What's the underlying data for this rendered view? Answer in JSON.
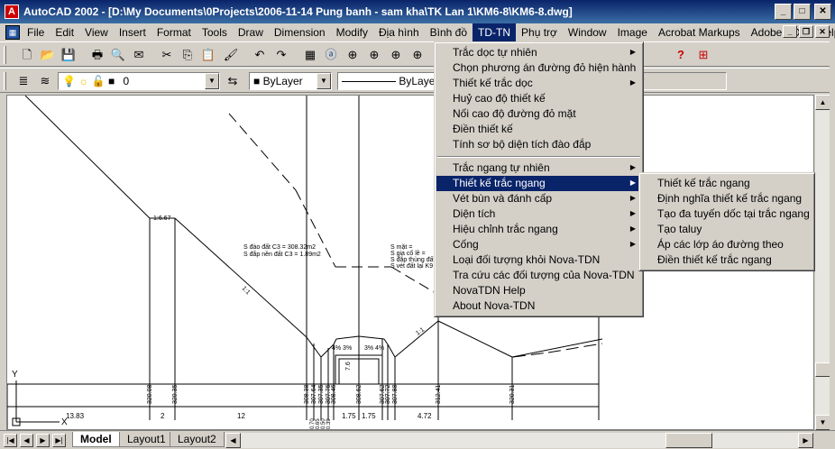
{
  "window": {
    "title": "AutoCAD 2002 - [D:\\My Documents\\0Projects\\2006-11-14 Pung banh - sam kha\\TK Lan 1\\KM6-8\\KM6-8.dwg]",
    "app_icon": "A"
  },
  "menubar": {
    "items": [
      "File",
      "Edit",
      "View",
      "Insert",
      "Format",
      "Tools",
      "Draw",
      "Dimension",
      "Modify",
      "Địa hình",
      "Bình đồ",
      "TD-TN",
      "Phụ trợ",
      "Window",
      "Image",
      "Acrobat Markups",
      "Adobe PDF",
      "Help"
    ],
    "active": "TD-TN"
  },
  "toolbar2": {
    "layer_value": "0",
    "color_value": "ByLayer",
    "linetype_value": "ByLaye",
    "lineweight_value": "r"
  },
  "menu_tdtn": {
    "items": [
      {
        "label": "Trắc dọc tự nhiên",
        "submenu": true
      },
      {
        "label": "Chọn phương án đường đỏ hiện hành",
        "submenu": false
      },
      {
        "label": "Thiết kế trắc dọc",
        "submenu": true
      },
      {
        "label": "Huỷ cao độ thiết kế",
        "submenu": false
      },
      {
        "label": "Nối cao độ đường đỏ mặt",
        "submenu": false
      },
      {
        "label": "Điền thiết kế",
        "submenu": false
      },
      {
        "label": "Tính sơ bộ diện tích đào đắp",
        "submenu": false
      },
      {
        "separator": true
      },
      {
        "label": "Trắc ngang tự nhiên",
        "submenu": true
      },
      {
        "label": "Thiết kế trắc ngang",
        "submenu": true,
        "highlighted": true
      },
      {
        "label": "Vét bùn và đánh cấp",
        "submenu": true
      },
      {
        "label": "Diện tích",
        "submenu": true
      },
      {
        "label": "Hiệu chỉnh trắc ngang",
        "submenu": true
      },
      {
        "label": "Cống",
        "submenu": true
      },
      {
        "label": "Loại đối tượng khỏi Nova-TDN",
        "submenu": false
      },
      {
        "label": "Tra cứu các đối  tượng của Nova-TDN",
        "submenu": false
      },
      {
        "label": "NovaTDN Help",
        "submenu": false
      },
      {
        "label": "About Nova-TDN",
        "submenu": false
      }
    ]
  },
  "submenu_thietke_tracngang": {
    "items": [
      "Thiết kế trắc ngang",
      "Định nghĩa thiết kế trắc ngang",
      "Tạo đa tuyến dốc tại trắc ngang",
      "Tạo taluy",
      "Áp các lớp áo đường theo",
      "Điền thiết kế trắc ngang"
    ]
  },
  "drawing": {
    "labels": {
      "slope_a": "1:6.67",
      "slope_b": "1:1",
      "slope_c": "1:1",
      "note1a": "S đào đất C3 =      308.32m2",
      "note1b": "S đắp nền đất C3 =     1.89m2",
      "note2a": "S mặt =",
      "note2b": "S gia cố lề =",
      "note2c": "S đắp thùng đất =",
      "note2d": "S vét đất lại K9",
      "pct1": "4% 3%",
      "pct2": "3% 4%",
      "dim_h": "7.6",
      "axis_y": "Y",
      "axis_x": "X"
    },
    "station_values": [
      "320.08",
      "320.35",
      "308.38",
      "307.64",
      "307.35",
      "307.76",
      "308.46",
      "308.62",
      "307.62",
      "307.72",
      "307.88",
      "312.41",
      "320.31"
    ],
    "distances": [
      "13.83",
      "2",
      "12",
      "1.75",
      "1.75",
      "4.72"
    ],
    "small_dims": [
      "0.70",
      "0.65",
      "0.50",
      "0.39"
    ]
  },
  "layout_tabs": {
    "items": [
      "Model",
      "Layout1",
      "Layout2"
    ],
    "active": "Model"
  }
}
